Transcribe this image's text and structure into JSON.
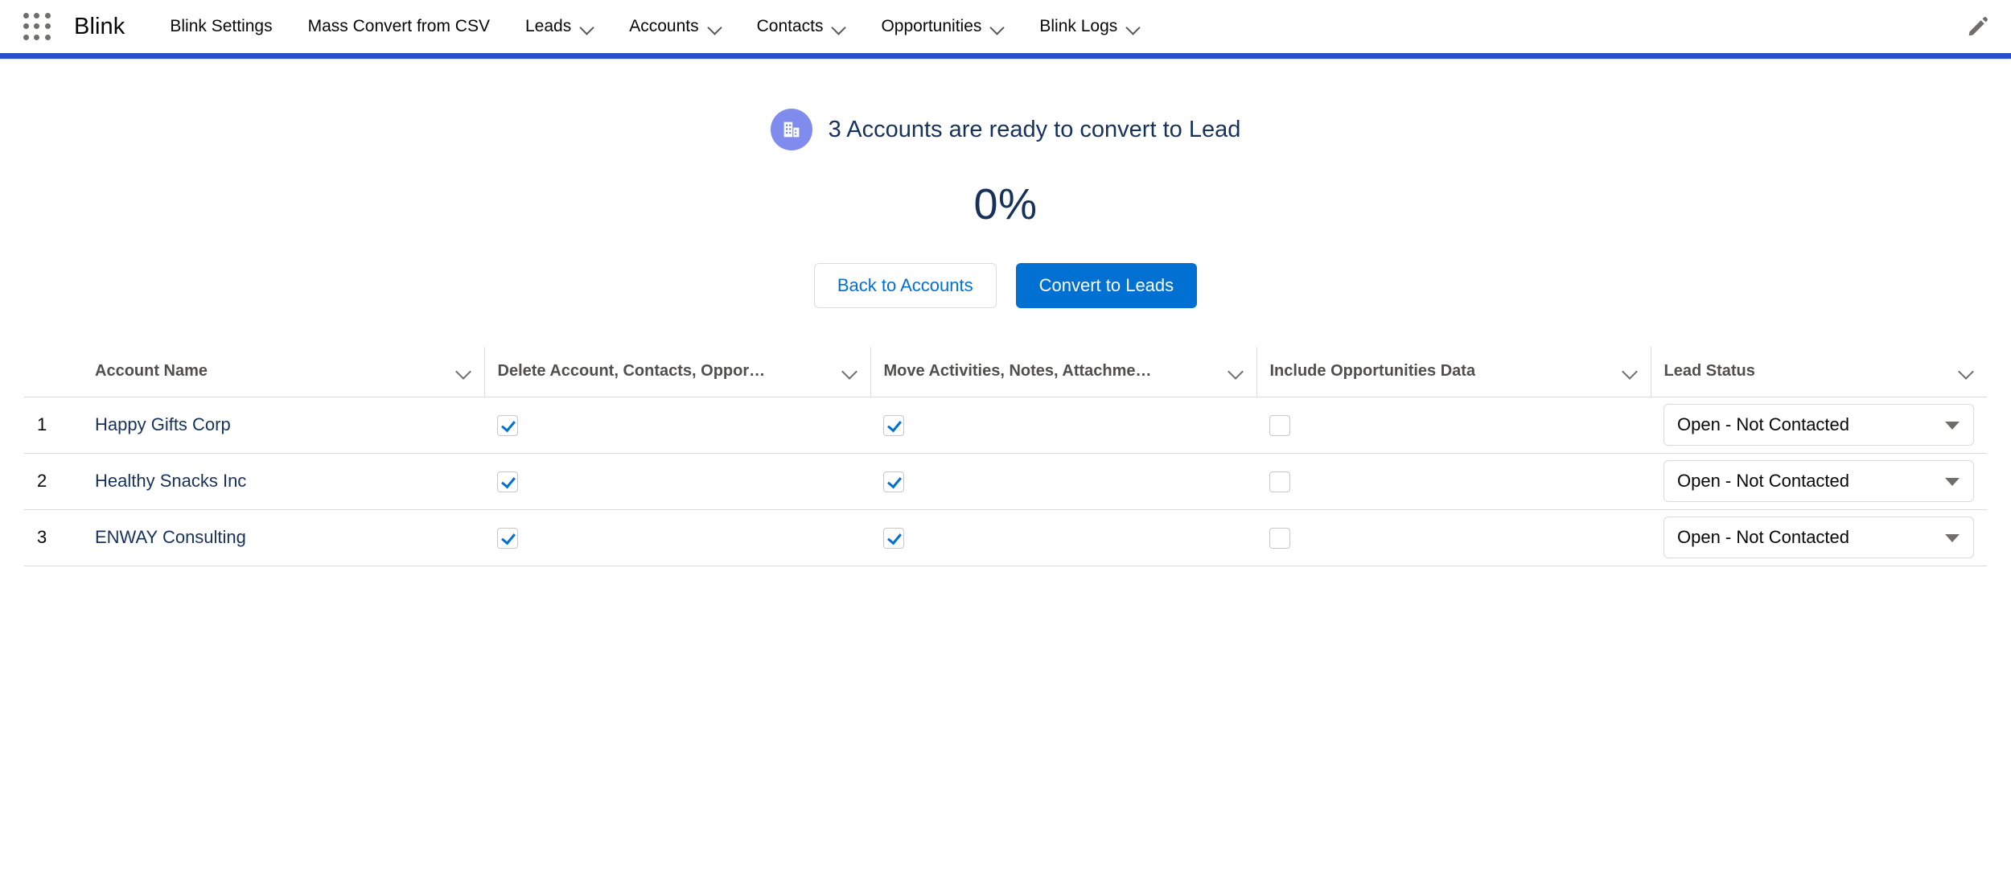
{
  "nav": {
    "app_launcher_icon": "app-launcher-grid-icon",
    "app_name": "Blink",
    "items": [
      {
        "label": "Blink Settings",
        "has_menu": false
      },
      {
        "label": "Mass Convert from CSV",
        "has_menu": false
      },
      {
        "label": "Leads",
        "has_menu": true
      },
      {
        "label": "Accounts",
        "has_menu": true
      },
      {
        "label": "Contacts",
        "has_menu": true
      },
      {
        "label": "Opportunities",
        "has_menu": true
      },
      {
        "label": "Blink Logs",
        "has_menu": true
      }
    ],
    "edit_icon": "pencil-icon",
    "underline_color": "#2b4ecc"
  },
  "header": {
    "object_icon": "account-building-icon",
    "object_icon_bg": "#7f8ced",
    "summary": "3 Accounts are ready to convert to Lead",
    "progress": "0%"
  },
  "actions": {
    "back_label": "Back to Accounts",
    "convert_label": "Convert to Leads",
    "brand_color": "#0070d2"
  },
  "table": {
    "columns": [
      {
        "label": "Account Name",
        "sortable": true
      },
      {
        "label": "Delete Account, Contacts, Oppor…",
        "sortable": true
      },
      {
        "label": "Move Activities, Notes, Attachme…",
        "sortable": true
      },
      {
        "label": "Include Opportunities Data",
        "sortable": true
      },
      {
        "label": "Lead Status",
        "sortable": true
      }
    ],
    "rows": [
      {
        "index": "1",
        "account_name": "Happy Gifts Corp",
        "delete_account": true,
        "move_activities": true,
        "include_opportunities": false,
        "lead_status": "Open - Not Contacted"
      },
      {
        "index": "2",
        "account_name": "Healthy Snacks Inc",
        "delete_account": true,
        "move_activities": true,
        "include_opportunities": false,
        "lead_status": "Open - Not Contacted"
      },
      {
        "index": "3",
        "account_name": "ENWAY Consulting",
        "delete_account": true,
        "move_activities": true,
        "include_opportunities": false,
        "lead_status": "Open - Not Contacted"
      }
    ],
    "lead_status_options": [
      "Open - Not Contacted"
    ]
  }
}
